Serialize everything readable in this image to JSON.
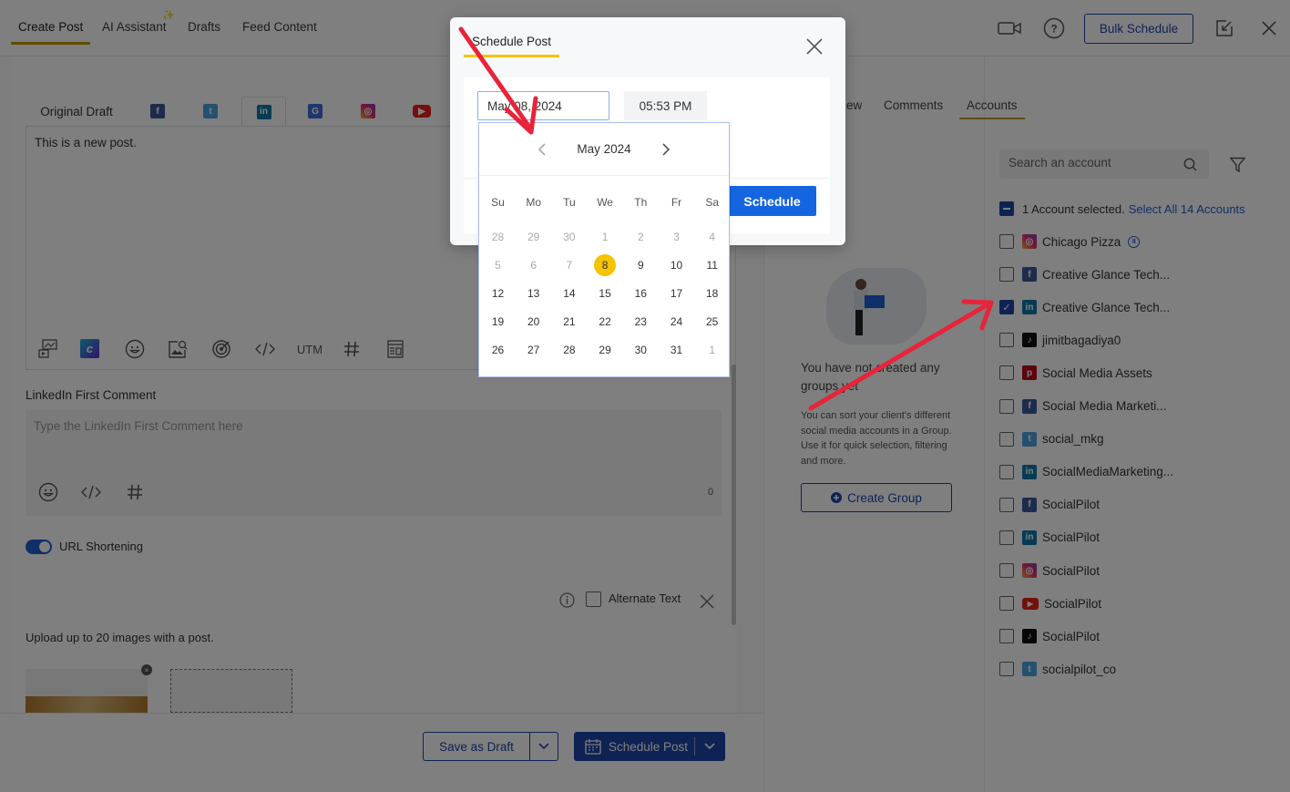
{
  "topbar": {
    "tabs": [
      {
        "label": "Create Post",
        "active": true
      },
      {
        "label": "AI Assistant",
        "active": false
      },
      {
        "label": "Drafts",
        "active": false
      },
      {
        "label": "Feed Content",
        "active": false
      }
    ],
    "ai_badge": "✨",
    "bulk_schedule_label": "Bulk Schedule"
  },
  "composer": {
    "original_draft_label": "Original Draft",
    "platform_tabs": [
      "facebook",
      "twitter",
      "linkedin",
      "google-business",
      "instagram",
      "youtube"
    ],
    "active_platform": "linkedin",
    "post_text": "This is a new post.",
    "tools": [
      "media-library",
      "canva",
      "emoji",
      "image-search",
      "target",
      "code",
      "UTM",
      "hashtag",
      "template"
    ],
    "utm_label": "UTM",
    "first_comment_label": "LinkedIn First Comment",
    "first_comment_placeholder": "Type the LinkedIn First Comment here",
    "first_comment_count": "0",
    "url_shortening_label": "URL Shortening",
    "url_shortening_on": true,
    "alternate_text_label": "Alternate Text",
    "upload_hint": "Upload up to 20 images with a post."
  },
  "footer": {
    "save_draft_label": "Save as Draft",
    "schedule_post_label": "Schedule Post"
  },
  "side_tabs": [
    {
      "label": "Preview",
      "visible_label": "ew",
      "active": false
    },
    {
      "label": "Comments",
      "active": false
    },
    {
      "label": "Accounts",
      "active": true
    }
  ],
  "groups": {
    "empty_title": "You have not created any groups yet",
    "empty_desc": "You can sort your client's different social media accounts in a Group. Use it for quick selection, filtering and more.",
    "create_label": "Create Group"
  },
  "accounts": {
    "search_placeholder": "Search an account",
    "selected_text": "1 Account selected.",
    "select_all_link": "Select All 14 Accounts",
    "list": [
      {
        "name": "Chicago Pizza",
        "network": "instagram",
        "checked": false,
        "paused": true
      },
      {
        "name": "Creative Glance Tech...",
        "network": "facebook",
        "checked": false
      },
      {
        "name": "Creative Glance Tech...",
        "network": "linkedin",
        "checked": true
      },
      {
        "name": "jimitbagadiya0",
        "network": "tiktok",
        "checked": false
      },
      {
        "name": "Social Media Assets",
        "network": "pinterest",
        "checked": false
      },
      {
        "name": "Social Media Marketi...",
        "network": "facebook",
        "checked": false
      },
      {
        "name": "social_mkg",
        "network": "twitter",
        "checked": false
      },
      {
        "name": "SocialMediaMarketing...",
        "network": "linkedin",
        "checked": false
      },
      {
        "name": "SocialPilot",
        "network": "facebook",
        "checked": false
      },
      {
        "name": "SocialPilot",
        "network": "linkedin",
        "checked": false
      },
      {
        "name": "SocialPilot",
        "network": "instagram",
        "checked": false
      },
      {
        "name": "SocialPilot",
        "network": "youtube",
        "checked": false
      },
      {
        "name": "SocialPilot",
        "network": "tiktok",
        "checked": false
      },
      {
        "name": "socialpilot_co",
        "network": "twitter",
        "checked": false
      }
    ]
  },
  "modal": {
    "title": "Schedule Post",
    "date_value": "May 08, 2024",
    "time_value": "05:53 PM",
    "schedule_label": "Schedule",
    "calendar": {
      "month_label": "May 2024",
      "weekdays": [
        "Su",
        "Mo",
        "Tu",
        "We",
        "Th",
        "Fr",
        "Sa"
      ],
      "weeks": [
        [
          {
            "d": "28",
            "m": 1
          },
          {
            "d": "29",
            "m": 1
          },
          {
            "d": "30",
            "m": 1
          },
          {
            "d": "1",
            "m": 1
          },
          {
            "d": "2",
            "m": 1
          },
          {
            "d": "3",
            "m": 1
          },
          {
            "d": "4",
            "m": 1
          }
        ],
        [
          {
            "d": "5",
            "m": 1
          },
          {
            "d": "6",
            "m": 1
          },
          {
            "d": "7",
            "m": 1
          },
          {
            "d": "8",
            "s": 1
          },
          {
            "d": "9"
          },
          {
            "d": "10"
          },
          {
            "d": "11"
          }
        ],
        [
          {
            "d": "12"
          },
          {
            "d": "13"
          },
          {
            "d": "14"
          },
          {
            "d": "15"
          },
          {
            "d": "16"
          },
          {
            "d": "17"
          },
          {
            "d": "18"
          }
        ],
        [
          {
            "d": "19"
          },
          {
            "d": "20"
          },
          {
            "d": "21"
          },
          {
            "d": "22"
          },
          {
            "d": "23"
          },
          {
            "d": "24"
          },
          {
            "d": "25"
          }
        ],
        [
          {
            "d": "26"
          },
          {
            "d": "27"
          },
          {
            "d": "28"
          },
          {
            "d": "29"
          },
          {
            "d": "30"
          },
          {
            "d": "31"
          },
          {
            "d": "1",
            "m": 1
          }
        ]
      ],
      "selected_day": "8"
    }
  },
  "colors": {
    "brand_blue": "#1d46a8",
    "schedule_blue": "#1565e0",
    "accent_yellow": "#f5c300",
    "annotation_red": "#e8233a"
  }
}
